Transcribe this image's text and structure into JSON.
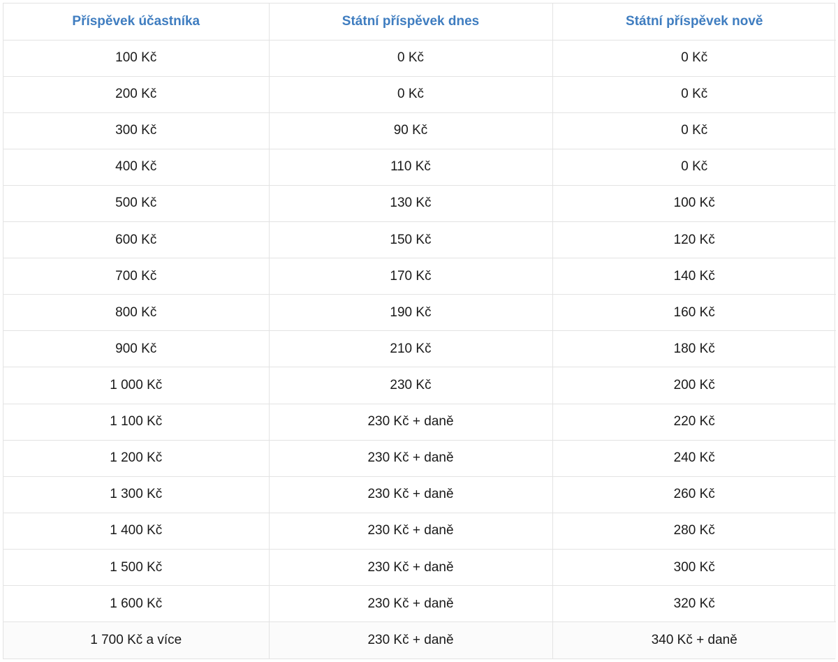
{
  "table": {
    "headers": [
      "Příspěvek účastníka",
      "Státní příspěvek dnes",
      "Státní příspěvek nově"
    ],
    "rows": [
      [
        "100 Kč",
        "0 Kč",
        "0 Kč"
      ],
      [
        "200 Kč",
        "0 Kč",
        "0 Kč"
      ],
      [
        "300 Kč",
        "90 Kč",
        "0 Kč"
      ],
      [
        "400 Kč",
        "110 Kč",
        "0 Kč"
      ],
      [
        "500 Kč",
        "130 Kč",
        "100 Kč"
      ],
      [
        "600 Kč",
        "150 Kč",
        "120 Kč"
      ],
      [
        "700 Kč",
        "170 Kč",
        "140 Kč"
      ],
      [
        "800 Kč",
        "190 Kč",
        "160 Kč"
      ],
      [
        "900 Kč",
        "210 Kč",
        "180 Kč"
      ],
      [
        "1 000 Kč",
        "230 Kč",
        "200 Kč"
      ],
      [
        "1 100 Kč",
        "230 Kč + daně",
        "220 Kč"
      ],
      [
        "1 200 Kč",
        "230 Kč + daně",
        "240 Kč"
      ],
      [
        "1 300 Kč",
        "230 Kč + daně",
        "260 Kč"
      ],
      [
        "1 400 Kč",
        "230 Kč + daně",
        "280 Kč"
      ],
      [
        "1 500 Kč",
        "230 Kč + daně",
        "300 Kč"
      ],
      [
        "1 600 Kč",
        "230 Kč + daně",
        "320 Kč"
      ],
      [
        "1 700 Kč a více",
        "230 Kč + daně",
        "340 Kč + daně"
      ]
    ]
  },
  "colors": {
    "header_text": "#3f7dc0",
    "cell_text": "#1a1a1a",
    "border": "#e3e3e3"
  }
}
